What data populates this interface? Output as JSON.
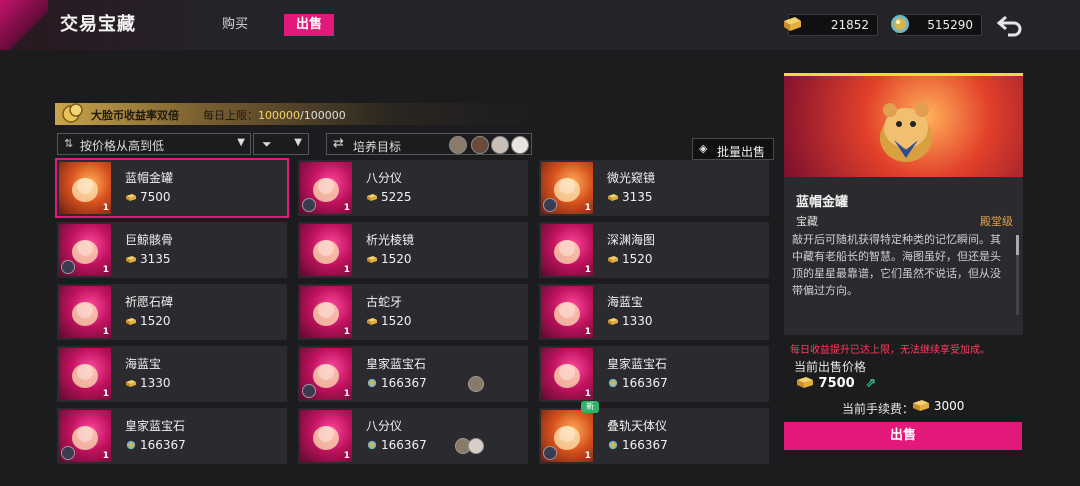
{
  "header": {
    "title": "交易宝藏",
    "tabs": [
      {
        "label": "购买",
        "active": false
      },
      {
        "label": "出售",
        "active": true
      }
    ],
    "currency_gold": "21852",
    "currency_gem": "515290"
  },
  "bonus": {
    "title": "大脸币收益率双倍",
    "limit_label": "每日上限：",
    "limit_current": "100000",
    "limit_sep": "/",
    "limit_max": "100000"
  },
  "filters": {
    "sort_label": "按价格从高到低",
    "target_label": "培养目标",
    "batch_sell_label": "批量出售"
  },
  "items": [
    {
      "name": "蓝帽金罐",
      "price": "7500",
      "qty": "1",
      "selected": true
    },
    {
      "name": "八分仪",
      "price": "5225",
      "qty": "1"
    },
    {
      "name": "微光窥镜",
      "price": "3135",
      "qty": "1"
    },
    {
      "name": "巨鲸骸骨",
      "price": "3135",
      "qty": "1"
    },
    {
      "name": "析光棱镜",
      "price": "1520",
      "qty": "1"
    },
    {
      "name": "深渊海图",
      "price": "1520",
      "qty": "1"
    },
    {
      "name": "祈愿石碑",
      "price": "1520",
      "qty": "1"
    },
    {
      "name": "古蛇牙",
      "price": "1520",
      "qty": "1"
    },
    {
      "name": "海蓝宝",
      "price": "1330",
      "qty": "1"
    },
    {
      "name": "海蓝宝",
      "price": "1330",
      "qty": "1"
    },
    {
      "name": "皇家蓝宝石",
      "price": "166367",
      "qty": "1"
    },
    {
      "name": "皇家蓝宝石",
      "price": "166367",
      "qty": "1"
    },
    {
      "name": "皇家蓝宝石",
      "price": "166367",
      "qty": "1"
    },
    {
      "name": "八分仪",
      "price": "166367",
      "qty": "1"
    },
    {
      "name": "叠轨天体仪",
      "price": "166367",
      "qty": "1",
      "new_label": "新"
    }
  ],
  "new_tag": "新",
  "detail": {
    "name": "蓝帽金罐",
    "type": "宝藏",
    "grade": "殿堂级",
    "description": "敲开后可随机获得特定种类的记忆瞬间。其中藏有老船长的智慧。海图虽好，但还是头顶的星星最靠谱，它们虽然不说话，但从没带偏过方向。",
    "warning": "每日收益提升已达上限，无法继续享受加成。",
    "price_label": "当前出售价格",
    "price": "7500",
    "fee_label": "当前手续费：",
    "fee": "3000",
    "sell_label": "出售"
  },
  "colors": {
    "accent": "#e3197a",
    "gold": "#e0a24a",
    "warning": "#ff3b5c"
  }
}
